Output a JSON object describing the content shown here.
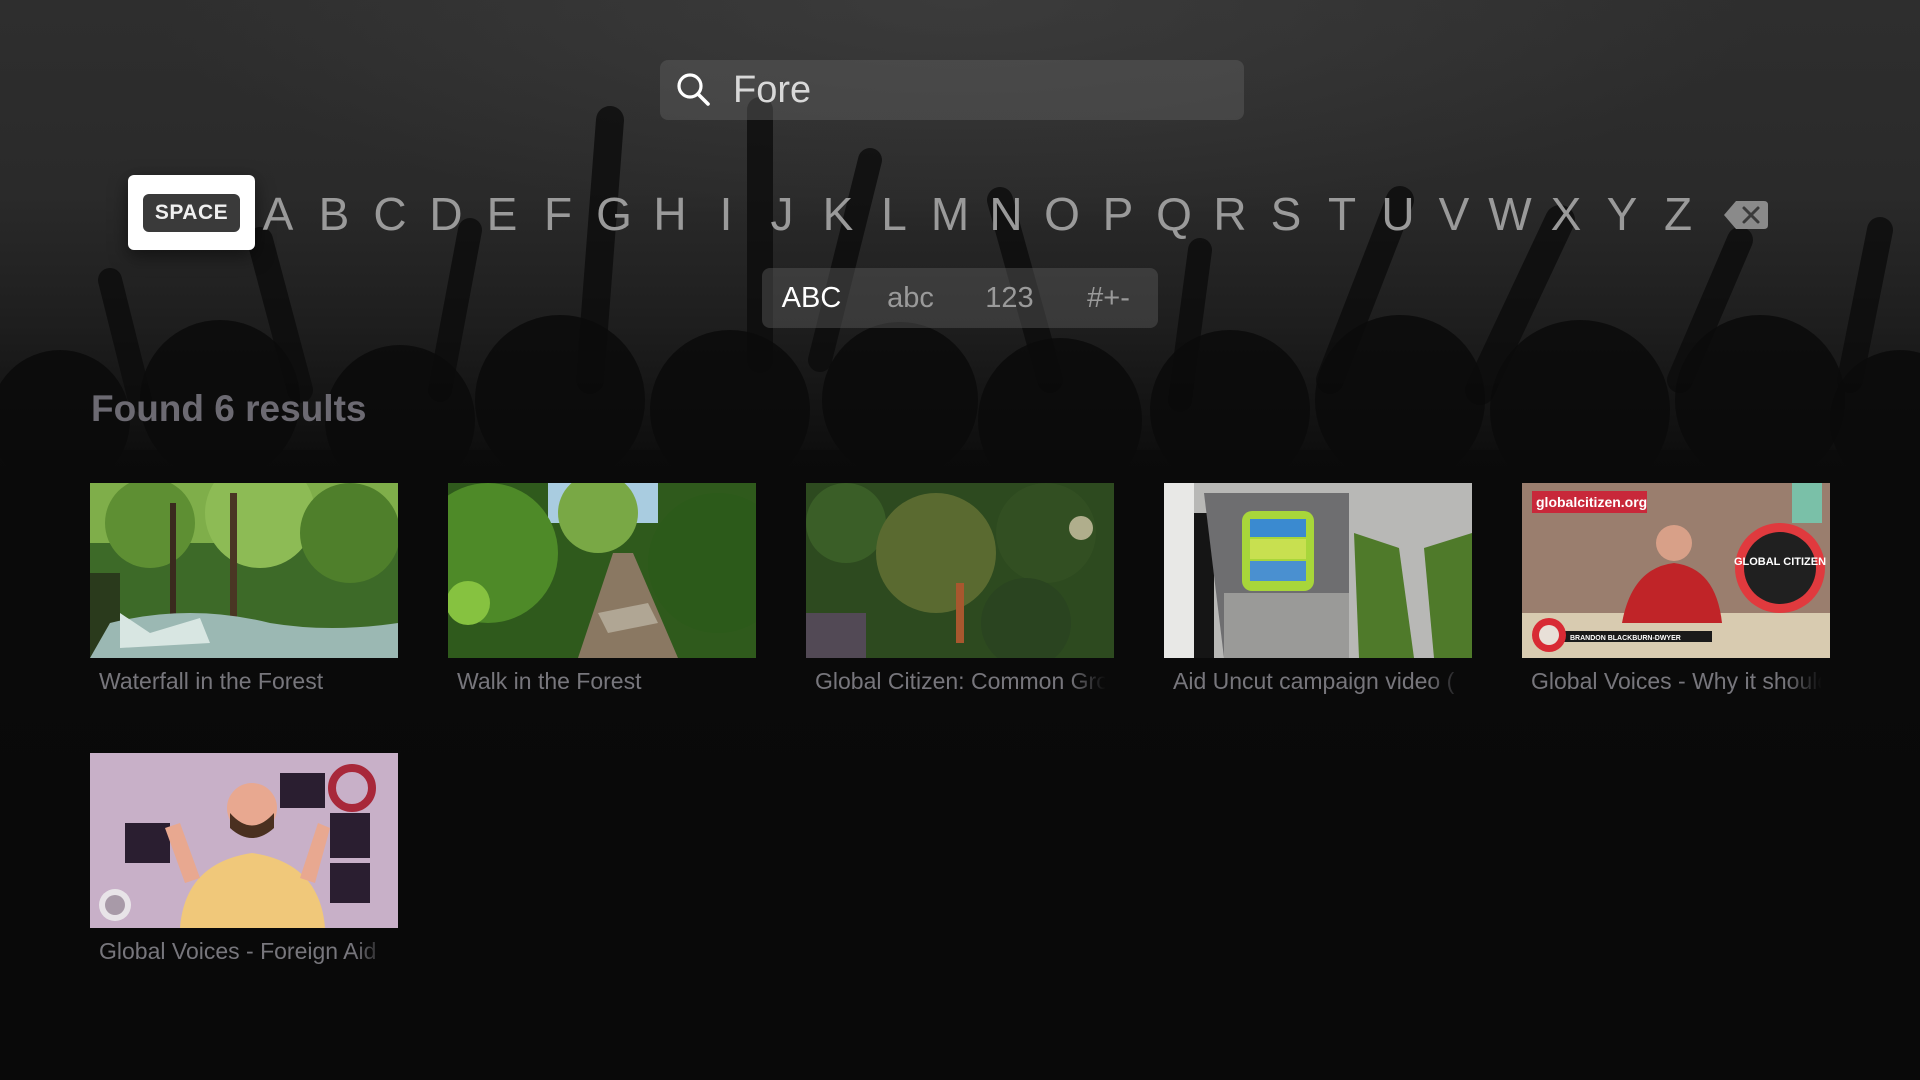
{
  "search": {
    "query": "Fore",
    "icon": "search-icon"
  },
  "keyboard": {
    "space_label": "SPACE",
    "letters": [
      "A",
      "B",
      "C",
      "D",
      "E",
      "F",
      "G",
      "H",
      "I",
      "J",
      "K",
      "L",
      "M",
      "N",
      "O",
      "P",
      "Q",
      "R",
      "S",
      "T",
      "U",
      "V",
      "W",
      "X",
      "Y",
      "Z"
    ],
    "backspace_icon": "backspace-icon",
    "modes": [
      {
        "label": "ABC",
        "active": true
      },
      {
        "label": "abc",
        "active": false
      },
      {
        "label": "123",
        "active": false
      },
      {
        "label": "#+-",
        "active": false
      }
    ]
  },
  "results": {
    "heading": "Found 6 results",
    "items": [
      {
        "title": "Waterfall in the Forest",
        "thumb": "forest-waterfall"
      },
      {
        "title": "Walk in the Forest",
        "thumb": "forest-path"
      },
      {
        "title": "Global Citizen: Common Ground",
        "thumb": "aerial-canopy"
      },
      {
        "title": "Aid Uncut campaign video (",
        "thumb": "ticket-gate"
      },
      {
        "title": "Global Voices - Why it should",
        "thumb": "presenter-red-shirt",
        "overlay_text": "globalcitizen.org",
        "lower_third": "BRANDON BLACKBURN-DWYER",
        "badge_text": "GLOBAL CITIZEN"
      },
      {
        "title": "Global Voices - Foreign Aid",
        "thumb": "presenter-yellow-shirt"
      }
    ]
  }
}
